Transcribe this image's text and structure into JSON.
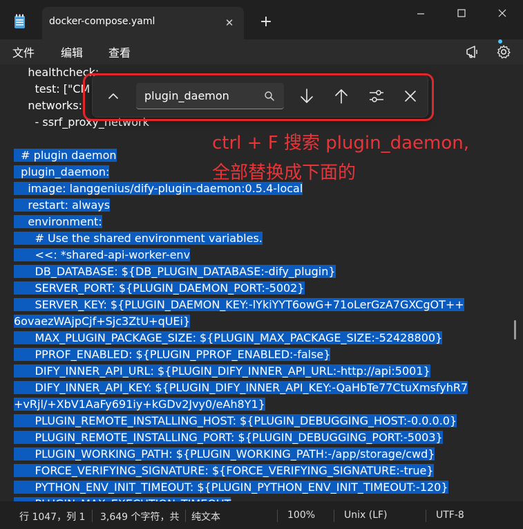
{
  "titlebar": {
    "tab_title": "docker-compose.yaml",
    "tab_close_glyph": "✕",
    "new_tab_glyph": "+",
    "icons": [
      "notepad-icon",
      "close-icon",
      "plus-icon",
      "minimize-icon",
      "maximize-icon",
      "close-window-icon"
    ]
  },
  "menu": {
    "file": "文件",
    "edit": "编辑",
    "view": "查看",
    "icons": [
      "copilot-icon",
      "settings-gear-icon"
    ]
  },
  "find": {
    "value": "plugin_daemon",
    "icons": [
      "chevron-up-icon",
      "search-icon",
      "arrow-down-icon",
      "arrow-up-icon",
      "options-sliders-icon",
      "close-icon"
    ],
    "highlight_color": "#e0282b"
  },
  "annotation": {
    "line1": "ctrl + F 搜索 plugin_daemon,",
    "line2": "全部替换成下面的",
    "color": "#e8353a"
  },
  "editor": {
    "selection_color": "#0b5cbe",
    "lines": [
      {
        "text": "    healthcheck:",
        "sel": false
      },
      {
        "text": "      test: [\"CM",
        "sel": false
      },
      {
        "text": "    networks:",
        "sel": false
      },
      {
        "text": "      - ssrf_proxy_network",
        "sel": false
      },
      {
        "text": "",
        "sel": false
      },
      {
        "text": "  # plugin daemon",
        "sel": true
      },
      {
        "text": "  plugin_daemon:",
        "sel": true
      },
      {
        "text": "    image: langgenius/dify-plugin-daemon:0.5.4-local",
        "sel": true
      },
      {
        "text": "    restart: always",
        "sel": true
      },
      {
        "text": "    environment:",
        "sel": true
      },
      {
        "text": "      # Use the shared environment variables.",
        "sel": true
      },
      {
        "text": "      <<: *shared-api-worker-env",
        "sel": true
      },
      {
        "text": "      DB_DATABASE: ${DB_PLUGIN_DATABASE:-dify_plugin}",
        "sel": true
      },
      {
        "text": "      SERVER_PORT: ${PLUGIN_DAEMON_PORT:-5002}",
        "sel": true
      },
      {
        "text": "      SERVER_KEY: ${PLUGIN_DAEMON_KEY:-lYkiYYT6owG+71oLerGzA7GXCgOT++",
        "sel": true
      },
      {
        "text": "6ovaezWAjpCjf+Sjc3ZtU+qUEi}",
        "sel": true
      },
      {
        "text": "      MAX_PLUGIN_PACKAGE_SIZE: ${PLUGIN_MAX_PACKAGE_SIZE:-52428800}",
        "sel": true
      },
      {
        "text": "      PPROF_ENABLED: ${PLUGIN_PPROF_ENABLED:-false}",
        "sel": true
      },
      {
        "text": "      DIFY_INNER_API_URL: ${PLUGIN_DIFY_INNER_API_URL:-http://api:5001}",
        "sel": true
      },
      {
        "text": "      DIFY_INNER_API_KEY: ${PLUGIN_DIFY_INNER_API_KEY:-QaHbTe77CtuXmsfyhR7",
        "sel": true
      },
      {
        "text": "+vRjl/+XbV1AaFy691iy+kGDv2Jvy0/eAh8Y1}",
        "sel": true
      },
      {
        "text": "      PLUGIN_REMOTE_INSTALLING_HOST: ${PLUGIN_DEBUGGING_HOST:-0.0.0.0}",
        "sel": true
      },
      {
        "text": "      PLUGIN_REMOTE_INSTALLING_PORT: ${PLUGIN_DEBUGGING_PORT:-5003}",
        "sel": true
      },
      {
        "text": "      PLUGIN_WORKING_PATH: ${PLUGIN_WORKING_PATH:-/app/storage/cwd}",
        "sel": true
      },
      {
        "text": "      FORCE_VERIFYING_SIGNATURE: ${FORCE_VERIFYING_SIGNATURE:-true}",
        "sel": true
      },
      {
        "text": "      PYTHON_ENV_INIT_TIMEOUT: ${PLUGIN_PYTHON_ENV_INIT_TIMEOUT:-120}",
        "sel": true
      },
      {
        "text": "      PLUGIN_MAX_EXECUTION_TIMEOUT",
        "sel": true
      }
    ]
  },
  "status": {
    "position": "行 1047，列 1",
    "chars": "3,649 个字符，共",
    "format": "纯文本",
    "zoom": "100%",
    "eol": "Unix (LF)",
    "encoding": "UTF-8"
  }
}
